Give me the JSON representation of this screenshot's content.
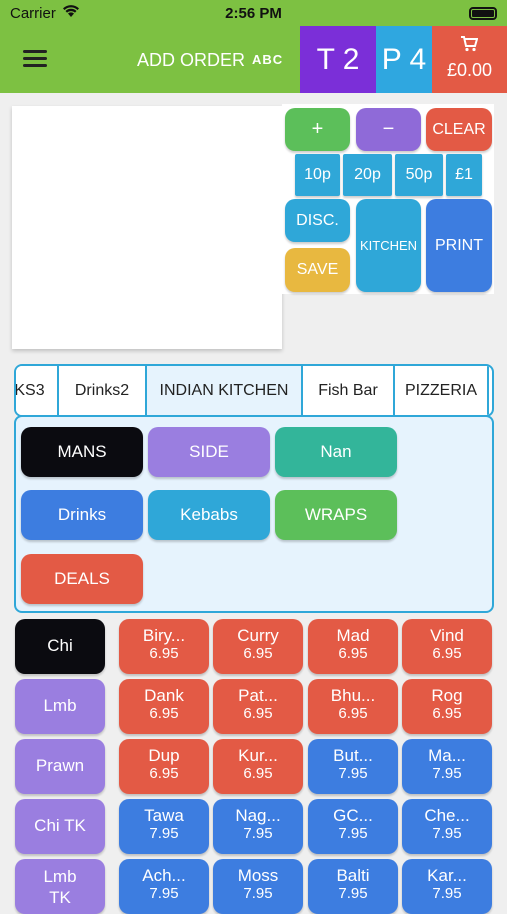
{
  "status": {
    "carrier": "Carrier",
    "time": "2:56 PM"
  },
  "header": {
    "title": "ADD ORDER",
    "abc_label": "ABC",
    "table": "T 2",
    "persons": "P 4",
    "cart_total": "£0.00"
  },
  "keypad": {
    "plus": "+",
    "minus": "−",
    "clear": "CLEAR",
    "p10": "10p",
    "p20": "20p",
    "p50": "50p",
    "pound1": "£1",
    "disc": "DISC.",
    "kitchen": "KITCHEN",
    "print": "PRINT",
    "save": "SAVE"
  },
  "tabs": [
    "KS3",
    "Drinks2",
    "INDIAN KITCHEN",
    "Fish Bar",
    "PIZZERIA"
  ],
  "categories": [
    "MANS",
    "SIDE",
    "Nan",
    "Drinks",
    "Kebabs",
    "WRAPS",
    "DEALS"
  ],
  "sides": [
    "Chi",
    "Lmb",
    "Prawn",
    "Chi TK",
    "Lmb TK"
  ],
  "items": [
    {
      "name": "Biry...",
      "price": "6.95"
    },
    {
      "name": "Curry",
      "price": "6.95"
    },
    {
      "name": "Mad",
      "price": "6.95"
    },
    {
      "name": "Vind",
      "price": "6.95"
    },
    {
      "name": "Dank",
      "price": "6.95"
    },
    {
      "name": "Pat...",
      "price": "6.95"
    },
    {
      "name": "Bhu...",
      "price": "6.95"
    },
    {
      "name": "Rog",
      "price": "6.95"
    },
    {
      "name": "Dup",
      "price": "6.95"
    },
    {
      "name": "Kur...",
      "price": "6.95"
    },
    {
      "name": "But...",
      "price": "7.95"
    },
    {
      "name": "Ma...",
      "price": "7.95"
    },
    {
      "name": "Tawa",
      "price": "7.95"
    },
    {
      "name": "Nag...",
      "price": "7.95"
    },
    {
      "name": "GC...",
      "price": "7.95"
    },
    {
      "name": "Che...",
      "price": "7.95"
    },
    {
      "name": "Ach...",
      "price": "7.95"
    },
    {
      "name": "Moss",
      "price": "7.95"
    },
    {
      "name": "Balti",
      "price": "7.95"
    },
    {
      "name": "Kar...",
      "price": "7.95"
    }
  ],
  "colors": {
    "green": "#7dc142",
    "purple": "#7b2fd8",
    "blue": "#2fa7e0",
    "red": "#e35a45"
  }
}
